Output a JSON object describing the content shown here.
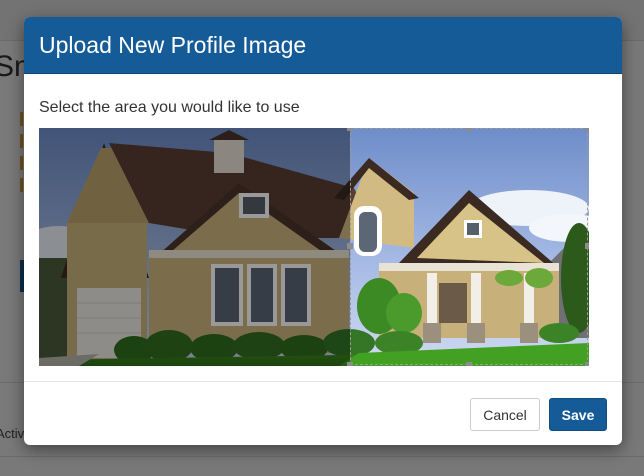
{
  "background_page": {
    "heading_fragment": "Sm",
    "bottom_text_fragment": "Activ"
  },
  "modal": {
    "title": "Upload New Profile Image",
    "instruction": "Select the area you would like to use",
    "buttons": {
      "cancel_label": "Cancel",
      "save_label": "Save"
    }
  },
  "crop": {
    "selection_start_fraction": 0.566,
    "selection_width_fraction": 0.433
  },
  "colors": {
    "header_bg": "#155b98",
    "primary_button": "#155b98"
  },
  "icons": {
    "photo": "house-photo"
  }
}
